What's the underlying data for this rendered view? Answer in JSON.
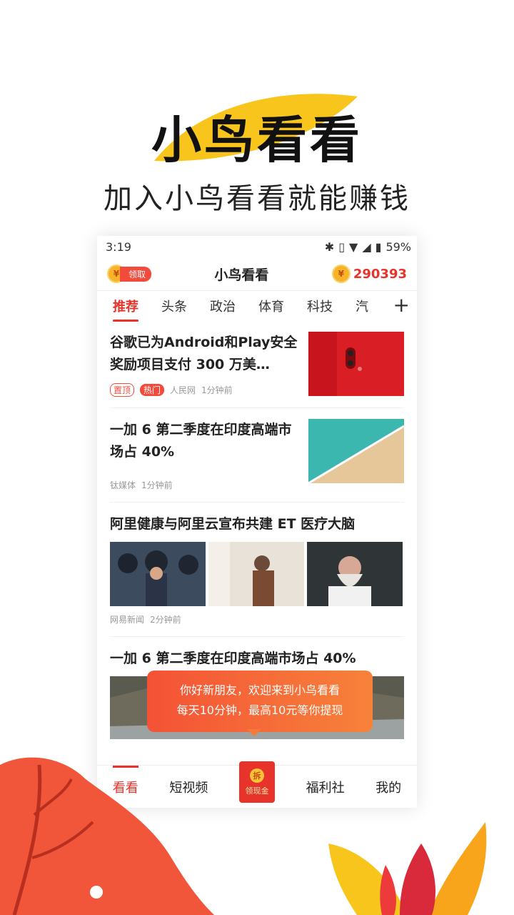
{
  "hero": {
    "title": "小鸟看看",
    "subtitle": "加入小鸟看看就能赚钱"
  },
  "status_bar": {
    "time": "3:19",
    "battery": "59%"
  },
  "app_bar": {
    "claim_label": "领取",
    "coin_symbol": "¥",
    "title": "小鸟看看",
    "balance": "290393"
  },
  "tabs": [
    "推荐",
    "头条",
    "政治",
    "体育",
    "科技",
    "汽"
  ],
  "tab_add": "+",
  "news": [
    {
      "title": "谷歌已为Android和Play安全奖励项目支付 300 万美…",
      "tags": [
        "置顶",
        "热门"
      ],
      "source": "人民网",
      "time": "1分钟前"
    },
    {
      "title": "一加 6 第二季度在印度高端市场占 40%",
      "source": "钛媒体",
      "time": "1分钟前"
    },
    {
      "title": "阿里健康与阿里云宣布共建 ET 医疗大脑",
      "source": "网易新闻",
      "time": "2分钟前"
    },
    {
      "title": "一加 6 第二季度在印度高端市场占 40%"
    }
  ],
  "popup": {
    "line1": "你好新朋友，欢迎来到小鸟看看",
    "line2": "每天10分钟，最高10元等你提现"
  },
  "bottom_nav": {
    "items": [
      "看看",
      "短视频",
      "福利社",
      "我的"
    ],
    "center_badge": "拆",
    "center_label": "领现金"
  },
  "colors": {
    "accent": "#e8332a",
    "coin": "#f6b32b",
    "leaf_yellow": "#f8c51c"
  }
}
